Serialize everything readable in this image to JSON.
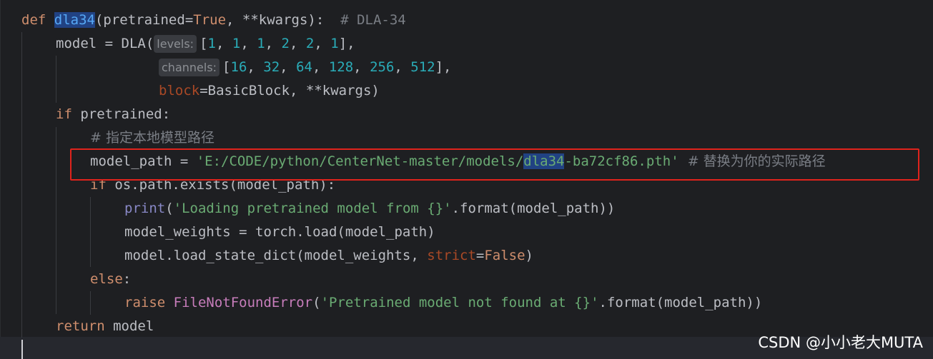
{
  "code": {
    "l1_def": "def",
    "l1_fn": "dla34",
    "l1_paren": "(pretrained=",
    "l1_true": "True",
    "l1_rest": ", **kwargs):  ",
    "l1_comment": "# DLA-34",
    "l2_pre": "model = DLA(",
    "l2_hint": "levels:",
    "l2_open": "[",
    "l2_nums": [
      "1",
      "1",
      "1",
      "2",
      "2",
      "1"
    ],
    "l2_close": "],",
    "l3_hint": "channels:",
    "l3_open": "[",
    "l3_nums": [
      "16",
      "32",
      "64",
      "128",
      "256",
      "512"
    ],
    "l3_close": "],",
    "l4_param": "block",
    "l4_rest": "=BasicBlock, **kwargs)",
    "l5_kw": "if",
    "l5_rest": " pretrained:",
    "l6_comment": "# 指定本地模型路径",
    "l7_var": "model_path = ",
    "l7_str_a": "'E:/CODE/python/CenterNet-master/models/",
    "l7_str_hl": "dla34",
    "l7_str_b": "-ba72cf86.pth'",
    "l7_comment": "  # 替换为你的实际路径",
    "l8_kw": "if",
    "l8_rest": " os.path.exists(model_path):",
    "l9_builtin": "print",
    "l9_open": "(",
    "l9_str": "'Loading pretrained model from {}'",
    "l9_rest": ".format(model_path))",
    "l10_text": "model_weights = torch.load(model_path)",
    "l11_pre": "model.load_state_dict(model_weights, ",
    "l11_param": "strict",
    "l11_eq": "=",
    "l11_false": "False",
    "l11_close": ")",
    "l12_kw": "else",
    "l12_colon": ":",
    "l13_kw": "raise",
    "l13_cls": "FileNotFoundError",
    "l13_open": "(",
    "l13_str": "'Pretrained model not found at {}'",
    "l13_rest": ".format(model_path))",
    "l14_kw": "return",
    "l14_rest": " model"
  },
  "watermark": "CSDN @小小老大MUTA",
  "colors": {
    "background": "#1e1f22",
    "keyword": "#cf8e6d",
    "string": "#6aab73",
    "number": "#2aacb8",
    "comment": "#7a7e85",
    "annotation_box": "#e0231c"
  }
}
